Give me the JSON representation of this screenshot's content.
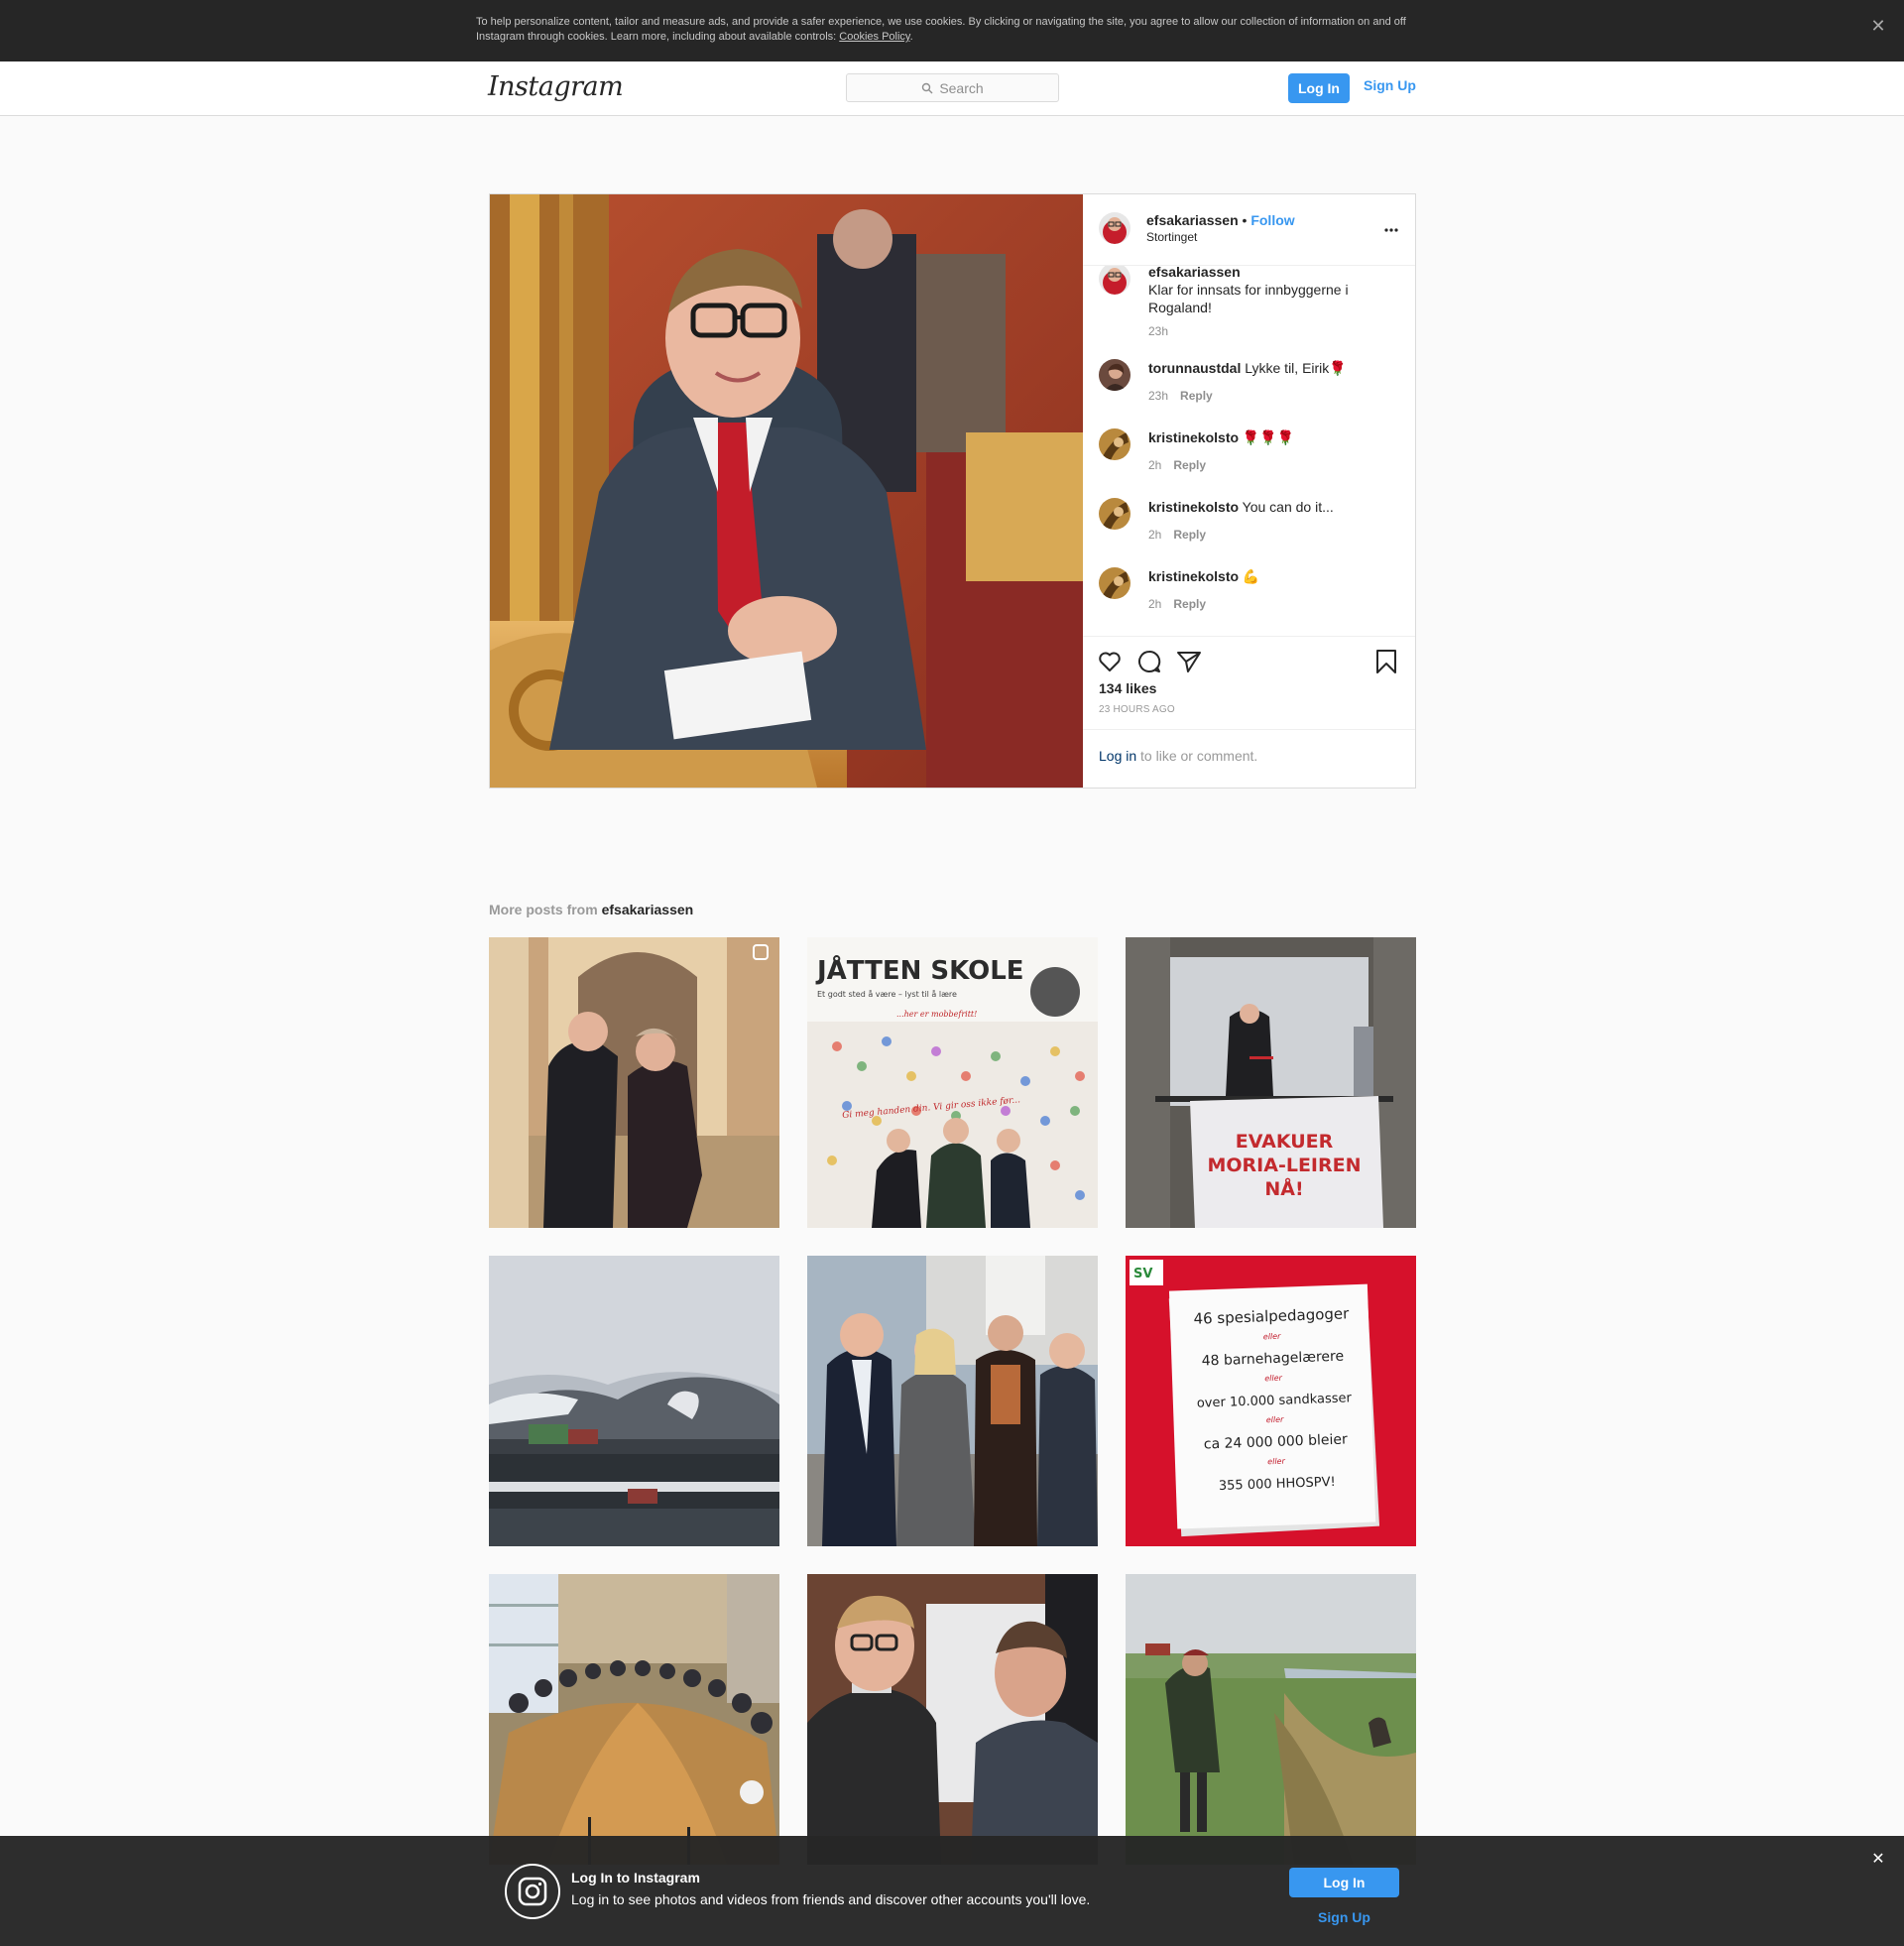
{
  "cookie_bar": {
    "text": "To help personalize content, tailor and measure ads, and provide a safer experience, we use cookies. By clicking or navigating the site, you agree to allow our collection of information on and off Instagram through cookies. Learn more, including about available controls: ",
    "link": "Cookies Policy",
    "period": ".",
    "close": "✕"
  },
  "nav": {
    "logo": "Instagram",
    "search_placeholder": "Search",
    "login": "Log In",
    "signup": "Sign Up"
  },
  "post": {
    "username": "efsakariassen",
    "separator": " • ",
    "follow": "Follow",
    "location": "Stortinget",
    "comments": [
      {
        "user": "efsakariassen",
        "text": "Klar for innsats for innbyggerne i Rogaland!",
        "time": "23h",
        "reply": ""
      },
      {
        "user": "torunnaustdal",
        "text": " Lykke til, Eirik🌹",
        "time": "23h",
        "reply": "Reply"
      },
      {
        "user": "kristinekolsto",
        "text": " 🌹🌹🌹",
        "time": "2h",
        "reply": "Reply"
      },
      {
        "user": "kristinekolsto",
        "text": " You can do it...",
        "time": "2h",
        "reply": "Reply"
      },
      {
        "user": "kristinekolsto",
        "text": " 💪",
        "time": "2h",
        "reply": "Reply"
      }
    ],
    "likes": "134 likes",
    "time_ago": "23 HOURS AGO",
    "login_link": "Log in",
    "login_rest": " to like or comment."
  },
  "more_posts": {
    "label": "More posts from ",
    "username": "efsakariassen",
    "thumb_texts": {
      "school_title": "JÅTTEN SKOLE",
      "school_sub": "Et godt sted å være – lyst til å lære",
      "school_tag": "...her er mobbefritt!",
      "school_banner": "Gi meg handen din. Vi gir oss ikke før...",
      "banner_1": "EVAKUER",
      "banner_2": "MORIA-LEIREN",
      "banner_3": "NÅ!",
      "sv_logo": "SV",
      "paper_lines": [
        "46 spesialpedagoger",
        "eller",
        "48 barnehagelærere",
        "eller",
        "over 10.000 sandkasser",
        "eller",
        "ca 24 000 000 bleier",
        "eller",
        "355 000 HHOSPV!"
      ]
    }
  },
  "bottom_banner": {
    "title": "Log In to Instagram",
    "text": "Log in to see photos and videos from friends and discover other accounts you'll love.",
    "login": "Log In",
    "signup": "Sign Up",
    "close": "✕"
  },
  "colors": {
    "accent": "#3897f0",
    "dark_bar": "#262626",
    "border": "#dbdbdb"
  }
}
